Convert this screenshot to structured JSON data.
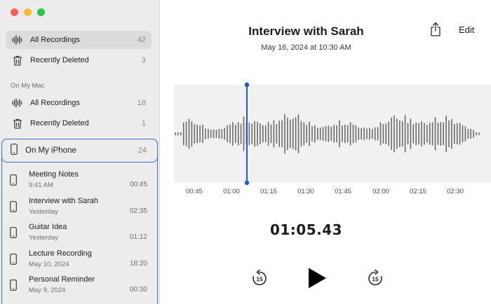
{
  "sidebar": {
    "top_items": [
      {
        "label": "All Recordings",
        "count": "42",
        "icon": "waveform-icon"
      },
      {
        "label": "Recently Deleted",
        "count": "3",
        "icon": "trash-icon"
      }
    ],
    "section_title": "On My Mac",
    "mac_items": [
      {
        "label": "All Recordings",
        "count": "18",
        "icon": "waveform-icon"
      },
      {
        "label": "Recently Deleted",
        "count": "1",
        "icon": "trash-icon"
      }
    ],
    "iphone": {
      "label": "On My iPhone",
      "count": "24",
      "icon": "iphone-icon"
    },
    "recordings": [
      {
        "title": "Meeting Notes",
        "date": "9:41 AM",
        "duration": "00:45"
      },
      {
        "title": "Interview with Sarah",
        "date": "Yesterday",
        "duration": "02:35"
      },
      {
        "title": "Guitar Idea",
        "date": "Yesterday",
        "duration": "01:12"
      },
      {
        "title": "Lecture Recording",
        "date": "May 10, 2024",
        "duration": "18:20"
      },
      {
        "title": "Personal Reminder",
        "date": "May 9, 2024",
        "duration": "00:30"
      }
    ]
  },
  "main": {
    "title": "Interview with Sarah",
    "date": "May 16, 2024 at 10:30 AM",
    "edit_label": "Edit",
    "timer": "01:05.43",
    "timeline_ticks": [
      "00:45",
      "01:00",
      "01:15",
      "01:30",
      "01:45",
      "02:00",
      "02:15",
      "02:30"
    ],
    "skip_seconds": "15"
  },
  "colors": {
    "accent": "#3d6fe0",
    "playhead": "#1f5ad6",
    "sidebar_bg": "#ececec",
    "waveform_bg": "#f1f1f1",
    "waveform_bars": "#6b6b6b"
  }
}
